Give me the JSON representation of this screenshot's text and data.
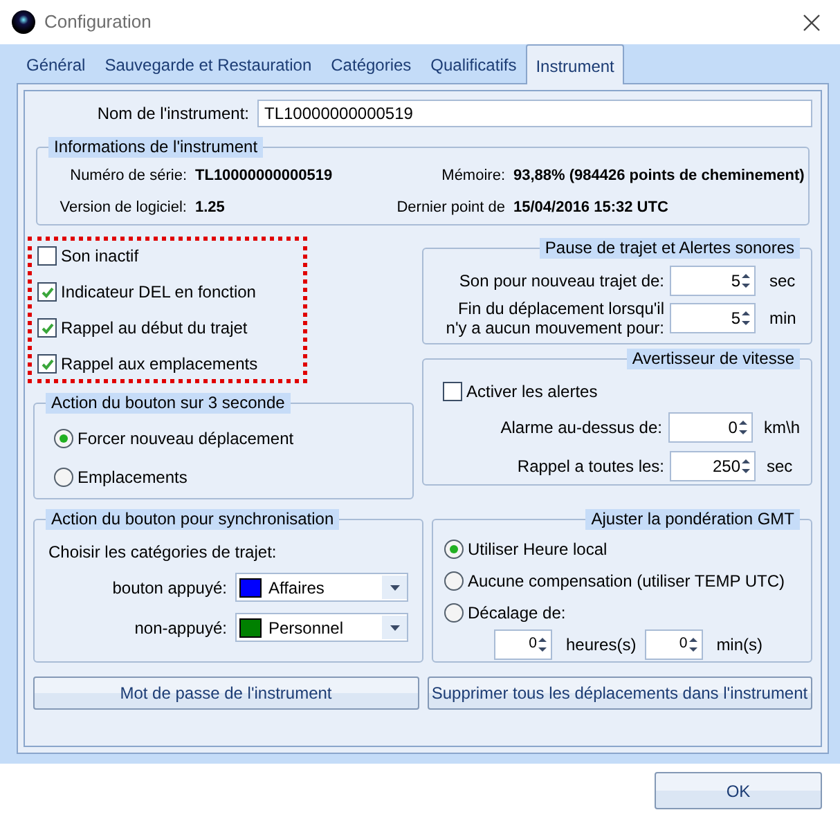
{
  "window": {
    "title": "Configuration"
  },
  "tabs": [
    {
      "label": "Général",
      "selected": false
    },
    {
      "label": "Sauvegarde et Restauration",
      "selected": false
    },
    {
      "label": "Catégories",
      "selected": false
    },
    {
      "label": "Qualificatifs",
      "selected": false
    },
    {
      "label": "Instrument",
      "selected": true
    }
  ],
  "instrument_name": {
    "label": "Nom de l'instrument:",
    "value": "TL10000000000519"
  },
  "info": {
    "title": "Informations de l'instrument",
    "fields": [
      {
        "label": "Numéro de série:",
        "value": "TL10000000000519"
      },
      {
        "label": "Mémoire:",
        "value": "93,88% (984426 points de cheminement)"
      },
      {
        "label": "Version de logiciel:",
        "value": "1.25"
      },
      {
        "label": "Dernier point de",
        "value": "15/04/2016 15:32 UTC"
      }
    ]
  },
  "options": {
    "highlighted": true,
    "items": [
      {
        "label": "Son inactif",
        "checked": false
      },
      {
        "label": "Indicateur DEL en fonction",
        "checked": true
      },
      {
        "label": "Rappel au début du trajet",
        "checked": true
      },
      {
        "label": "Rappel aux emplacements",
        "checked": true
      }
    ]
  },
  "button_action": {
    "title": "Action du bouton sur 3 seconde",
    "options": [
      {
        "label": "Forcer nouveau déplacement",
        "selected": true
      },
      {
        "label": "Emplacements",
        "selected": false
      }
    ]
  },
  "sync_action": {
    "title": "Action du bouton pour synchronisation",
    "prompt": "Choisir les catégories de trajet:",
    "rows": [
      {
        "label": "bouton appuyé:",
        "value": "Affaires",
        "color": "#0000ff"
      },
      {
        "label": "non-appuyé:",
        "value": "Personnel",
        "color": "#008000"
      }
    ]
  },
  "trip_pause": {
    "title": "Pause de trajet et Alertes sonores",
    "rows": [
      {
        "label": "Son pour nouveau trajet de:",
        "value": "5",
        "unit": "sec"
      },
      {
        "label": "Fin du déplacement lorsqu'il n'y a aucun mouvement pour:",
        "value": "5",
        "unit": "min"
      }
    ]
  },
  "speed_alert": {
    "title": "Avertisseur de vitesse",
    "enable": {
      "label": "Activer les alertes",
      "checked": false
    },
    "rows": [
      {
        "label": "Alarme au-dessus de:",
        "value": "0",
        "unit": "km\\h"
      },
      {
        "label": "Rappel a toutes les:",
        "value": "250",
        "unit": "sec"
      }
    ]
  },
  "gmt": {
    "title": "Ajuster la pondération GMT",
    "options": [
      {
        "label": "Utiliser Heure local",
        "selected": true
      },
      {
        "label": "Aucune compensation (utiliser TEMP UTC)",
        "selected": false
      },
      {
        "label": "Décalage de:",
        "selected": false
      }
    ],
    "offset": [
      {
        "value": "0",
        "unit": "heures(s)"
      },
      {
        "value": "0",
        "unit": "min(s)"
      }
    ]
  },
  "buttons": [
    {
      "label": "Mot de passe de l'instrument"
    },
    {
      "label": "Supprimer tous les déplacements dans l'instrument"
    }
  ],
  "ok_button": {
    "label": "OK"
  }
}
